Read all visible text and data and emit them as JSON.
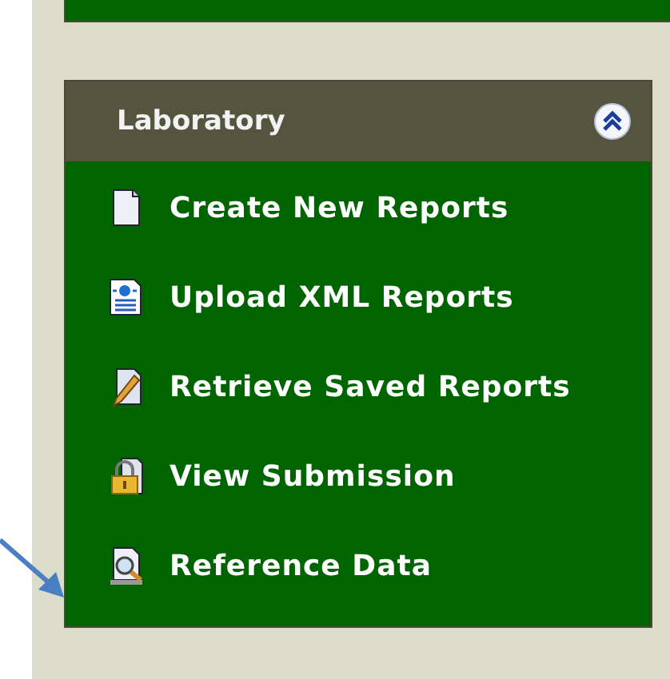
{
  "panel": {
    "title": "Laboratory",
    "expanded": true
  },
  "items": [
    {
      "label": "Create New Reports",
      "kind": "document"
    },
    {
      "label": "Upload XML Reports",
      "kind": "xml"
    },
    {
      "label": "Retrieve Saved Reports",
      "kind": "edit"
    },
    {
      "label": "View Submission",
      "kind": "lock"
    },
    {
      "label": "Reference Data",
      "kind": "search"
    }
  ]
}
